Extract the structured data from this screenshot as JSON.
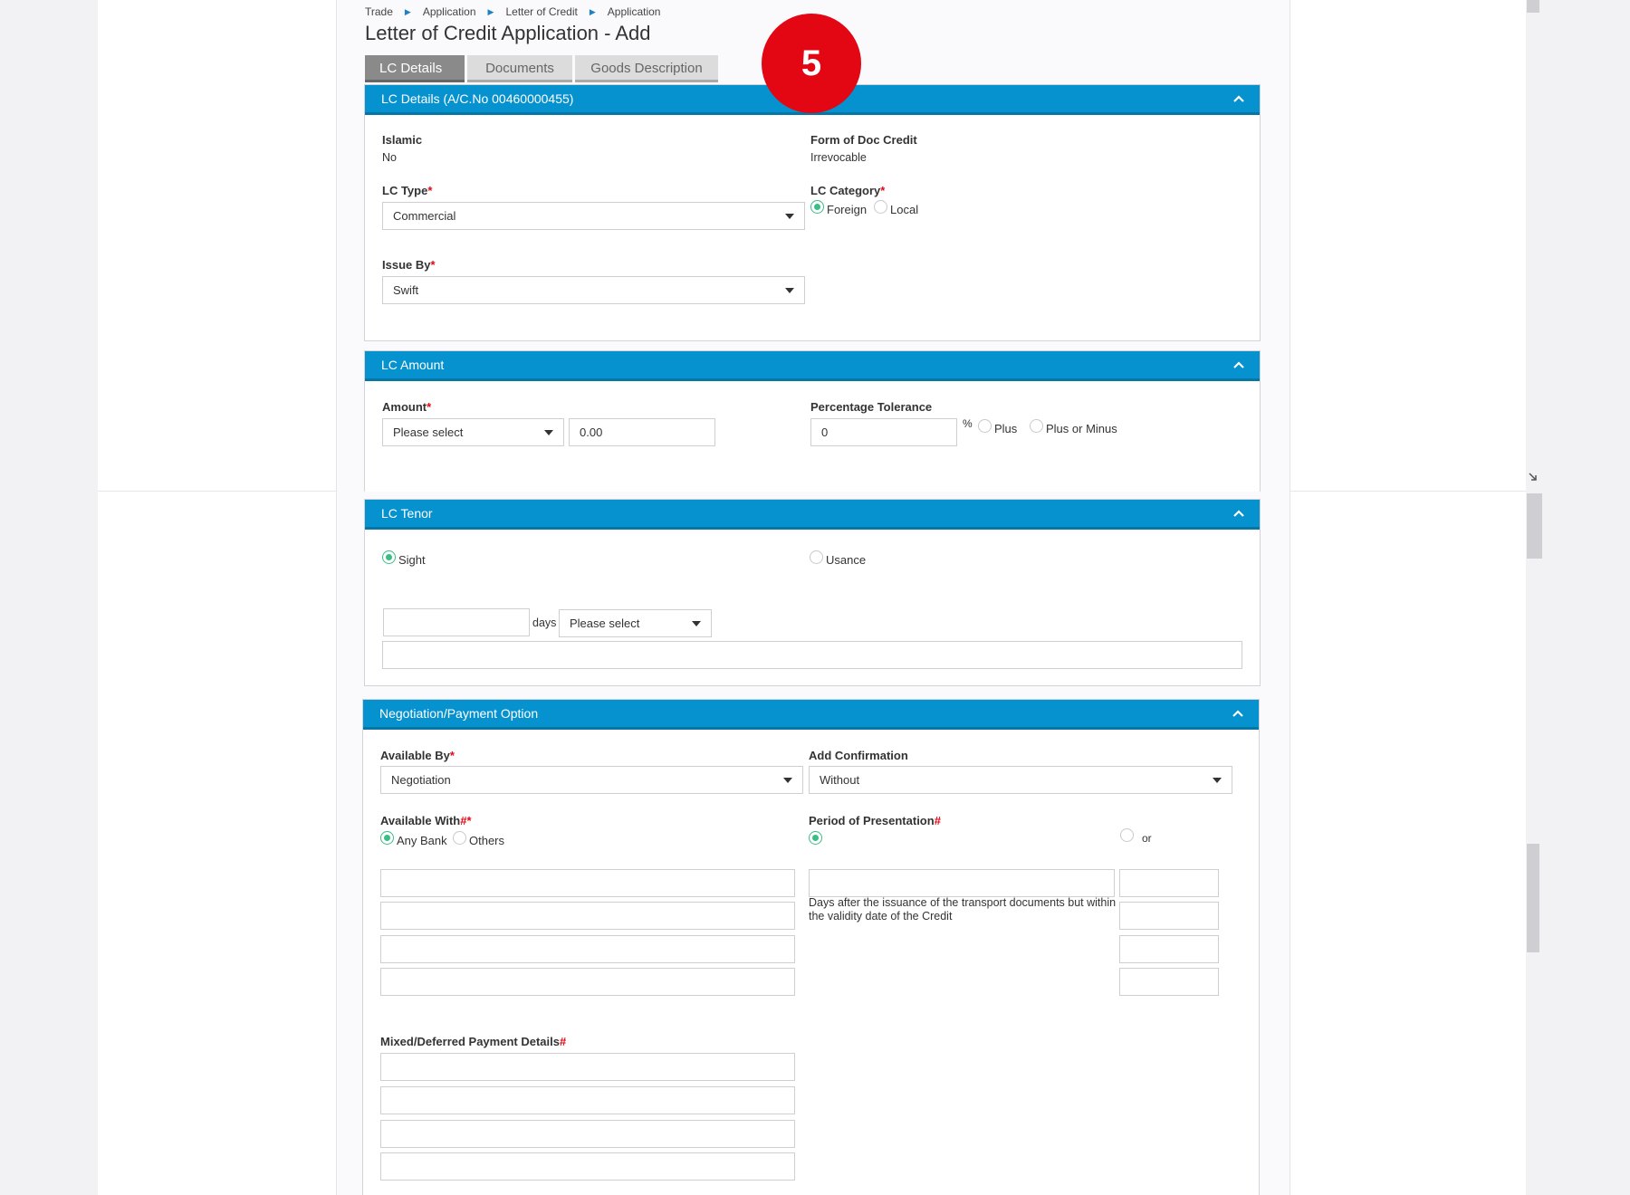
{
  "breadcrumb": [
    "Trade",
    "Application",
    "Letter of Credit",
    "Application"
  ],
  "page_title": "Letter of Credit Application - Add",
  "tabs": [
    {
      "label": "LC Details",
      "active": true
    },
    {
      "label": "Documents",
      "active": false
    },
    {
      "label": "Goods Description",
      "active": false
    }
  ],
  "step_badge": "5",
  "colors": {
    "header_blue": "#0592cf",
    "badge_red": "#e30613",
    "radio_green": "#3bbd86"
  },
  "lc_details": {
    "header": "LC Details (A/C.No 00460000455)",
    "islamic_label": "Islamic",
    "islamic_value": "No",
    "form_label": "Form of Doc Credit",
    "form_value": "Irrevocable",
    "lc_type_label": "LC Type",
    "lc_type_value": "Commercial",
    "lc_category_label": "LC Category",
    "category_options": [
      {
        "label": "Foreign",
        "selected": true
      },
      {
        "label": "Local",
        "selected": false
      }
    ],
    "issue_by_label": "Issue By",
    "issue_by_value": "Swift",
    "required_mark": "*"
  },
  "lc_amount": {
    "header": "LC Amount",
    "amount_label": "Amount",
    "currency_value": "Please select",
    "amount_value": "0.00",
    "tolerance_label": "Percentage Tolerance",
    "tolerance_value": "0",
    "percent_sign": "%",
    "tolerance_options": [
      {
        "label": "Plus",
        "selected": false
      },
      {
        "label": "Plus or Minus",
        "selected": false
      }
    ]
  },
  "lc_tenor": {
    "header": "LC Tenor",
    "sight_label": "Sight",
    "sight_selected": true,
    "usance_label": "Usance",
    "usance_selected": false,
    "days_value": "",
    "days_label": "days",
    "tenor_select_value": "Please select",
    "tenor_text_value": ""
  },
  "negotiation": {
    "header": "Negotiation/Payment Option",
    "available_by_label": "Available By",
    "available_by_value": "Negotiation",
    "add_confirmation_label": "Add Confirmation",
    "add_confirmation_value": "Without",
    "available_with_label": "Available With",
    "hash_mark": "#",
    "available_with_options": [
      {
        "label": "Any Bank",
        "selected": true
      },
      {
        "label": "Others",
        "selected": false
      }
    ],
    "period_label": "Period of Presentation",
    "period_or_label": "or",
    "period_note": "Days after the issuance of the transport documents but within the validity date of the Credit",
    "mixed_label": "Mixed/Deferred Payment Details"
  }
}
